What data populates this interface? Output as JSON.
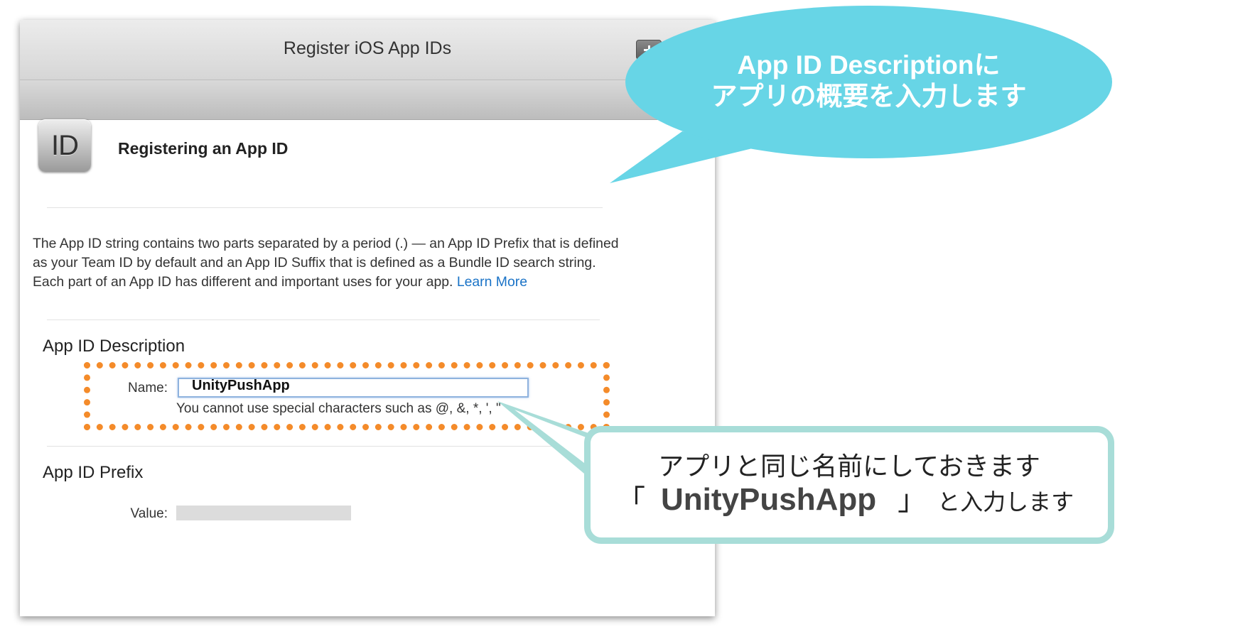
{
  "window": {
    "title": "Register iOS App IDs",
    "add_button": "add-icon",
    "search_button": "search-icon"
  },
  "header": {
    "icon_text": "ID",
    "title": "Registering an App ID"
  },
  "intro": {
    "text": "The App ID string contains two parts separated by a period (.) — an App ID Prefix that is defined as your Team ID by default and an App ID Suffix that is defined as a Bundle ID search string. Each part of an App ID has different and important uses for your app.",
    "link": "Learn More"
  },
  "description_section": {
    "title": "App ID Description",
    "name_label": "Name:",
    "name_value": "UnityPushApp",
    "hint": "You cannot use special characters such as @, &, *, ', \""
  },
  "prefix_section": {
    "title": "App ID Prefix",
    "value_label": "Value:"
  },
  "annotations": {
    "bubble_line1": "App ID Descriptionに",
    "bubble_line2": "アプリの概要を入力します",
    "callout_line1": "アプリと同じ名前にしておきます",
    "callout_open_bracket": "「",
    "callout_app_name": "UnityPushApp",
    "callout_close_bracket": "」",
    "callout_suffix": "と入力します"
  },
  "colors": {
    "highlight_dashes": "#f48b2a",
    "bubble_blue": "#67d5e6",
    "callout_border": "#a8ddd8",
    "link": "#1a73c7"
  }
}
